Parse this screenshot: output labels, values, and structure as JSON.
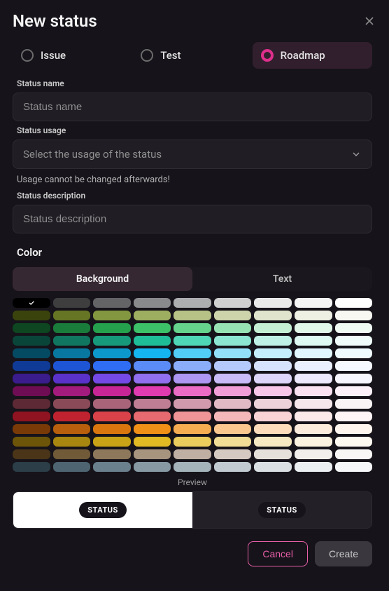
{
  "modal": {
    "title": "New status",
    "tabs": [
      {
        "label": "Issue",
        "selected": false
      },
      {
        "label": "Test",
        "selected": false
      },
      {
        "label": "Roadmap",
        "selected": true
      }
    ]
  },
  "fields": {
    "name_label": "Status name",
    "name_placeholder": "Status name",
    "usage_label": "Status usage",
    "usage_placeholder": "Select the usage of the status",
    "usage_helper": "Usage cannot be changed afterwards!",
    "desc_label": "Status description",
    "desc_placeholder": "Status description"
  },
  "color": {
    "section_label": "Color",
    "toggle_bg": "Background",
    "toggle_text": "Text",
    "selected_swatch": "#000000",
    "rows": [
      [
        "#000000",
        "#3e3e3f",
        "#646466",
        "#898a8c",
        "#adaeaf",
        "#d0d0d1",
        "#e9e9ea",
        "#f4f4f5",
        "#ffffff"
      ],
      [
        "#3b430d",
        "#667524",
        "#839640",
        "#9eae61",
        "#b7c287",
        "#cdd4ac",
        "#e0e4cd",
        "#edf0e2",
        "#f7f8f1"
      ],
      [
        "#0d4621",
        "#1a7c3b",
        "#25a04d",
        "#3cc068",
        "#66d38d",
        "#97e2b3",
        "#c4efd4",
        "#e0f7e9",
        "#f0fbf4"
      ],
      [
        "#0a4539",
        "#11765f",
        "#179a7c",
        "#1fbc98",
        "#4fd6b6",
        "#8be5d1",
        "#bef0e5",
        "#defaf2",
        "#effcf9"
      ],
      [
        "#054a63",
        "#0878a0",
        "#0d98cb",
        "#14b5f0",
        "#51cdf7",
        "#92e0fa",
        "#c4eefc",
        "#e1f6fe",
        "#f0fbff"
      ],
      [
        "#0f3b96",
        "#1e55d4",
        "#2e6df4",
        "#5a8bf7",
        "#8aacf9",
        "#b5c9fb",
        "#d7e2fd",
        "#ebf0fe",
        "#f5f8ff"
      ],
      [
        "#3a1c8d",
        "#5a32c9",
        "#7549e5",
        "#9070ee",
        "#ad97f3",
        "#c8bbf7",
        "#ded6fa",
        "#eee9fd",
        "#f7f5fe"
      ],
      [
        "#6f0d54",
        "#a31b7c",
        "#c82697",
        "#e03bb0",
        "#ea6cc4",
        "#f19ed8",
        "#f7c6e8",
        "#fbe2f3",
        "#fdf1f9"
      ],
      [
        "#5c2934",
        "#8b4a58",
        "#a9647a",
        "#c07e94",
        "#d29bad",
        "#e1b9c5",
        "#edd2da",
        "#f5e6eb",
        "#faf3f5"
      ],
      [
        "#8f1321",
        "#c0232f",
        "#d94249",
        "#e66a6f",
        "#ef9497",
        "#f5b8ba",
        "#f9d4d6",
        "#fce9ea",
        "#fef4f5"
      ],
      [
        "#7a3a08",
        "#b75f0c",
        "#d9770e",
        "#f09016",
        "#f6ad52",
        "#fac78e",
        "#fcdcbb",
        "#fdecdb",
        "#fef6ee"
      ],
      [
        "#6c5508",
        "#a7870f",
        "#c9a416",
        "#e1ba24",
        "#ebcd5e",
        "#f2dd97",
        "#f7eac3",
        "#fbf3e0",
        "#fdf9f0"
      ],
      [
        "#4a3518",
        "#715a38",
        "#8d785b",
        "#a7947f",
        "#bfb0a3",
        "#d5cac2",
        "#e6e0db",
        "#f1eeeb",
        "#f8f7f5"
      ],
      [
        "#2c3e47",
        "#4e6571",
        "#6a808c",
        "#8799a3",
        "#a4b2ba",
        "#c0cad0",
        "#d9dfe3",
        "#ebeff1",
        "#f5f7f8"
      ]
    ]
  },
  "preview": {
    "label": "Preview",
    "chip_text": "STATUS"
  },
  "footer": {
    "cancel_label": "Cancel",
    "create_label": "Create"
  }
}
